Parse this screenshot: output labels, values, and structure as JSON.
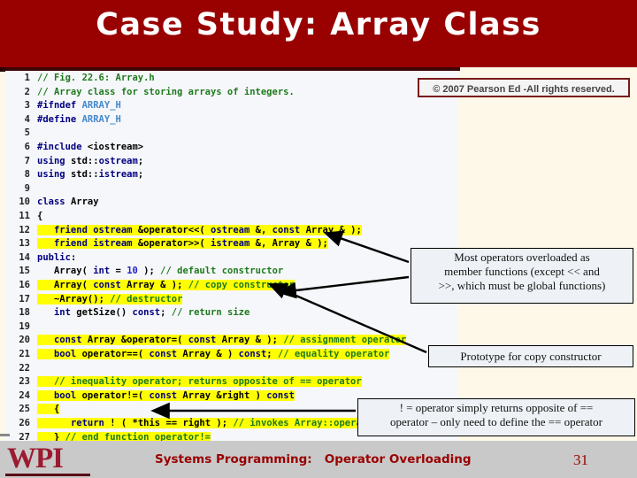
{
  "slide": {
    "title": "Case Study: Array Class",
    "banner_color": "#990000",
    "background_color": "#c9c9c9",
    "code_background": "#f6f7fa",
    "content_background": "#fdf8e8",
    "highlight_color": "#ffff00"
  },
  "copyright": {
    "text": "© 2007 Pearson Ed -All rights reserved."
  },
  "code": {
    "lines": [
      {
        "n": "1",
        "text": "// Fig. 22.6: Array.h"
      },
      {
        "n": "2",
        "text": "// Array class for storing arrays of integers."
      },
      {
        "n": "3",
        "text": "#ifndef ARRAY_H"
      },
      {
        "n": "4",
        "text": "#define ARRAY_H"
      },
      {
        "n": "5",
        "text": ""
      },
      {
        "n": "6",
        "text": "#include <iostream>"
      },
      {
        "n": "7",
        "text": "using std::ostream;"
      },
      {
        "n": "8",
        "text": "using std::istream;"
      },
      {
        "n": "9",
        "text": ""
      },
      {
        "n": "10",
        "text": "class Array"
      },
      {
        "n": "11",
        "text": "{"
      },
      {
        "n": "12",
        "text": "   friend ostream &operator<<( ostream &, const Array & );"
      },
      {
        "n": "13",
        "text": "   friend istream &operator>>( istream &, Array & );"
      },
      {
        "n": "14",
        "text": "public:"
      },
      {
        "n": "15",
        "text": "   Array( int = 10 ); // default constructor"
      },
      {
        "n": "16",
        "text": "   Array( const Array & ); // copy constructor"
      },
      {
        "n": "17",
        "text": "   ~Array(); // destructor"
      },
      {
        "n": "18",
        "text": "   int getSize() const; // return size"
      },
      {
        "n": "19",
        "text": ""
      },
      {
        "n": "20",
        "text": "   const Array &operator=( const Array & ); // assignment operator"
      },
      {
        "n": "21",
        "text": "   bool operator==( const Array & ) const; // equality operator"
      },
      {
        "n": "22",
        "text": ""
      },
      {
        "n": "23",
        "text": "   // inequality operator; returns opposite of == operator"
      },
      {
        "n": "24",
        "text": "   bool operator!=( const Array &right ) const"
      },
      {
        "n": "25",
        "text": "   {"
      },
      {
        "n": "26",
        "text": "      return ! ( *this == right ); // invokes Array::operator"
      },
      {
        "n": "27",
        "text": "   } // end function operator!="
      }
    ]
  },
  "callouts": [
    {
      "id": "members",
      "lines": [
        "Most operators overloaded as",
        "member functions (except << and",
        ">>, which must be global functions)"
      ]
    },
    {
      "id": "copyctor",
      "lines": [
        "Prototype for copy constructor"
      ]
    },
    {
      "id": "notequal",
      "lines": [
        "! = operator simply returns opposite of ==",
        "operator – only need to define the == operator"
      ]
    }
  ],
  "footer": {
    "logo": "WPI",
    "title": "Systems Programming:   Operator Overloading",
    "page": "31",
    "accent_color": "#990000"
  }
}
